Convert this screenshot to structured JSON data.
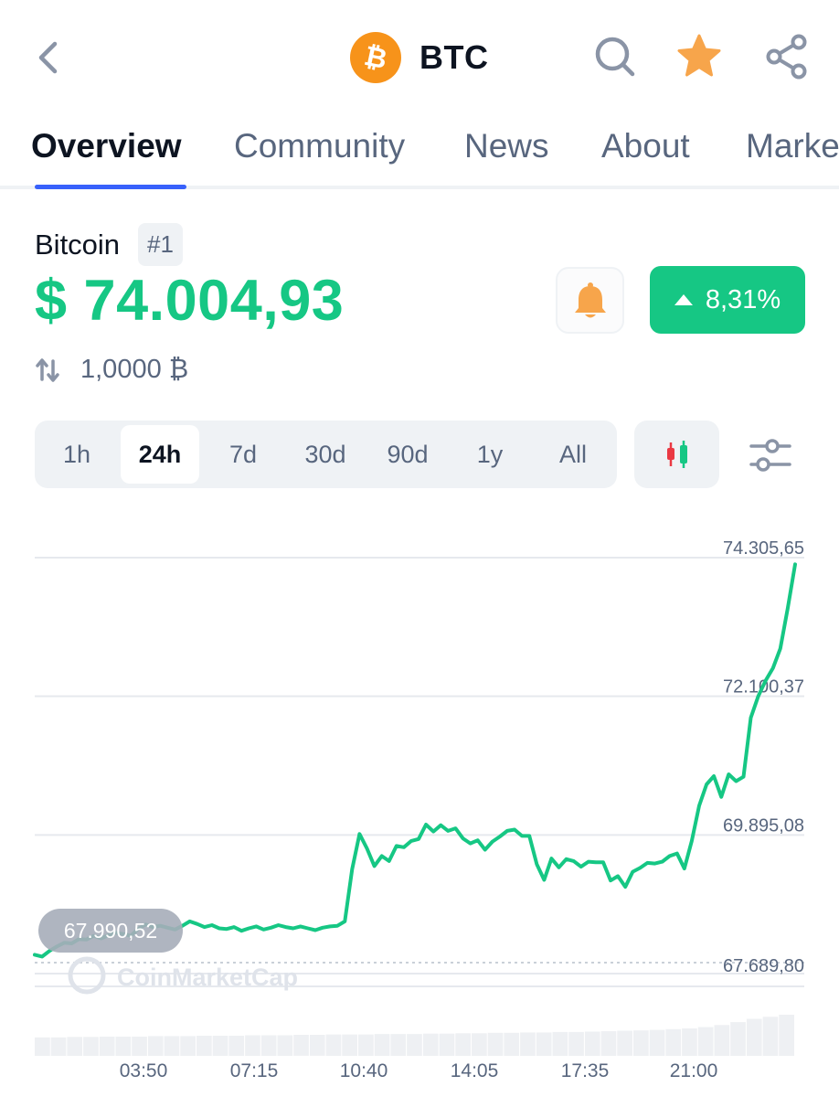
{
  "header": {
    "symbol": "BTC",
    "icons": [
      "back-arrow-icon",
      "bitcoin-logo-icon",
      "search-icon",
      "star-icon",
      "share-icon"
    ],
    "colors": {
      "star": "#f7a54b",
      "bitcoin": "#f7931a"
    }
  },
  "tabs": [
    {
      "label": "Overview",
      "active": true
    },
    {
      "label": "Community"
    },
    {
      "label": "News"
    },
    {
      "label": "About"
    },
    {
      "label": "Marke"
    }
  ],
  "coin": {
    "name": "Bitcoin",
    "rank": "#1",
    "price": "$ 74.004,93",
    "change": "8,31%",
    "change_direction": "up",
    "conversion": "1,0000 ₿",
    "colors": {
      "up": "#16c784",
      "accent": "#3861fb"
    }
  },
  "ranges": [
    {
      "label": "1h"
    },
    {
      "label": "24h",
      "active": true
    },
    {
      "label": "7d"
    },
    {
      "label": "30d"
    },
    {
      "label": "90d"
    },
    {
      "label": "1y"
    },
    {
      "label": "All"
    }
  ],
  "controls": {
    "icons": [
      "candlestick-icon",
      "chart-settings-icon",
      "bell-icon"
    ]
  },
  "chart_data": {
    "type": "line",
    "y_tick_labels": [
      "74.305,65",
      "72.100,37",
      "69.895,08",
      "67.689,80"
    ],
    "y_ticks": [
      74305.65,
      72100.37,
      69895.08,
      67689.8
    ],
    "x_tick_labels": [
      "03:50",
      "07:15",
      "10:40",
      "14:05",
      "17:35",
      "21:00"
    ],
    "start_label": "67.990,52",
    "start_value": 67990.52,
    "watermark": "CoinMarketCap",
    "ylim": [
      67689.8,
      74305.65
    ],
    "grid": true,
    "line_color": "#16c784",
    "series": [
      {
        "values": [
          67990,
          67960,
          68050,
          68120,
          68180,
          68170,
          68240,
          68230,
          68290,
          68250,
          68300,
          68340,
          68320,
          68290,
          68400,
          68470,
          68430,
          68450,
          68420,
          68390,
          68450,
          68520,
          68480,
          68430,
          68460,
          68410,
          68400,
          68430,
          68370,
          68410,
          68440,
          68390,
          68420,
          68460,
          68430,
          68410,
          68440,
          68410,
          68380,
          68420,
          68440,
          68450,
          68520,
          69350,
          69910,
          69680,
          69400,
          69560,
          69480,
          69720,
          69700,
          69800,
          69830,
          70060,
          69950,
          70050,
          69960,
          70000,
          69840,
          69760,
          69810,
          69660,
          69790,
          69870,
          69960,
          69980,
          69880,
          69880,
          69430,
          69180,
          69520,
          69380,
          69510,
          69480,
          69390,
          69470,
          69460,
          69460,
          69170,
          69240,
          69070,
          69310,
          69370,
          69450,
          69440,
          69470,
          69560,
          69600,
          69360,
          69800,
          70360,
          70700,
          70830,
          70500,
          70860,
          70750,
          70820,
          71760,
          72100,
          72350,
          72550,
          72860,
          73500,
          74200
        ]
      }
    ],
    "volume_series": [
      0.45,
      0.45,
      0.46,
      0.46,
      0.47,
      0.47,
      0.47,
      0.48,
      0.48,
      0.48,
      0.49,
      0.49,
      0.49,
      0.5,
      0.5,
      0.5,
      0.51,
      0.51,
      0.52,
      0.52,
      0.52,
      0.53,
      0.53,
      0.53,
      0.54,
      0.54,
      0.55,
      0.55,
      0.56,
      0.56,
      0.57,
      0.57,
      0.58,
      0.58,
      0.59,
      0.6,
      0.61,
      0.62,
      0.63,
      0.65,
      0.67,
      0.7,
      0.75,
      0.82,
      0.9,
      0.95,
      1.0
    ]
  }
}
